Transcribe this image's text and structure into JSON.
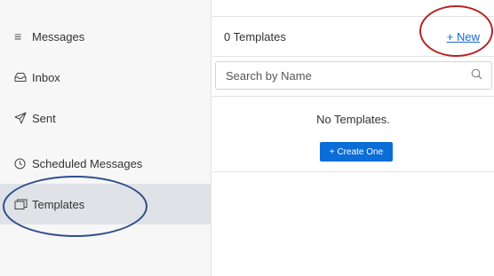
{
  "sidebar": {
    "header": {
      "label": "Messages",
      "icon": "menu-icon"
    },
    "items": [
      {
        "label": "Inbox",
        "icon": "inbox-icon"
      },
      {
        "label": "Sent",
        "icon": "send-icon"
      },
      {
        "label": "Scheduled Messages",
        "icon": "clock-icon"
      },
      {
        "label": "Templates",
        "icon": "folder-icon",
        "active": true
      }
    ]
  },
  "main": {
    "count_label": "0 Templates",
    "new_label": "+ New",
    "search": {
      "placeholder": "Search by Name"
    },
    "empty_text": "No Templates.",
    "create_label": "+ Create One"
  },
  "colors": {
    "accent": "#0a6dd8",
    "link": "#1a67d2",
    "active_bg": "#dfe2e6",
    "annotation_red": "#b52424",
    "annotation_blue": "#2f4e8c"
  }
}
